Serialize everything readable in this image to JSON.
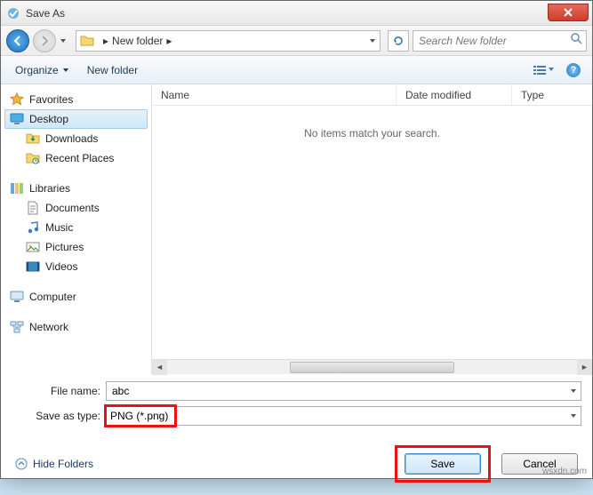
{
  "title": "Save As",
  "breadcrumb": {
    "location": "New folder"
  },
  "search": {
    "placeholder": "Search New folder"
  },
  "toolbar": {
    "organize": "Organize",
    "new_folder": "New folder"
  },
  "sidebar": {
    "favorites": {
      "label": "Favorites",
      "items": [
        "Desktop",
        "Downloads",
        "Recent Places"
      ]
    },
    "libraries": {
      "label": "Libraries",
      "items": [
        "Documents",
        "Music",
        "Pictures",
        "Videos"
      ]
    },
    "computer": {
      "label": "Computer"
    },
    "network": {
      "label": "Network"
    }
  },
  "columns": {
    "name": "Name",
    "date": "Date modified",
    "type": "Type"
  },
  "empty_message": "No items match your search.",
  "fields": {
    "filename_label": "File name:",
    "filename_value": "abc",
    "type_label": "Save as type:",
    "type_value": "PNG (*.png)"
  },
  "footer": {
    "hide_folders": "Hide Folders",
    "save": "Save",
    "cancel": "Cancel"
  },
  "watermark": "wsxdn.com"
}
